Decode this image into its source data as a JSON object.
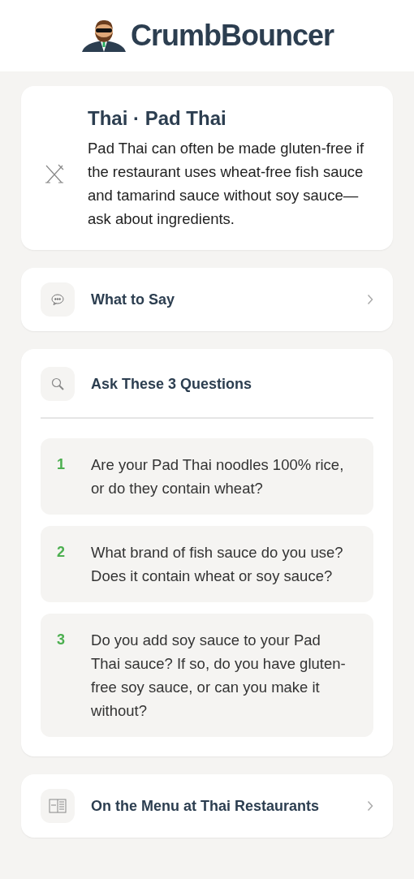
{
  "header": {
    "logo_text": "CrumbBouncer"
  },
  "dish": {
    "title": "Thai · Pad Thai",
    "description": "Pad Thai can often be made gluten-free if the restaurant uses wheat-free fish sauce and tamarind sauce without soy sauce—ask about ingredients."
  },
  "sections": [
    {
      "kind": "link",
      "title": "What to Say"
    },
    {
      "kind": "questions",
      "title": "Ask These 3 Questions",
      "questions": [
        {
          "number": "1",
          "text": "Are your Pad Thai noodles 100% rice, or do they contain wheat?"
        },
        {
          "number": "2",
          "text": "What brand of fish sauce do you use? Does it contain wheat or soy sauce?"
        },
        {
          "number": "3",
          "text": "Do you add soy sauce to your Pad Thai sauce? If so, do you have gluten-free soy sauce, or can you make it without?"
        }
      ]
    },
    {
      "kind": "link",
      "title": "On the Menu at Thai Restaurants"
    }
  ]
}
